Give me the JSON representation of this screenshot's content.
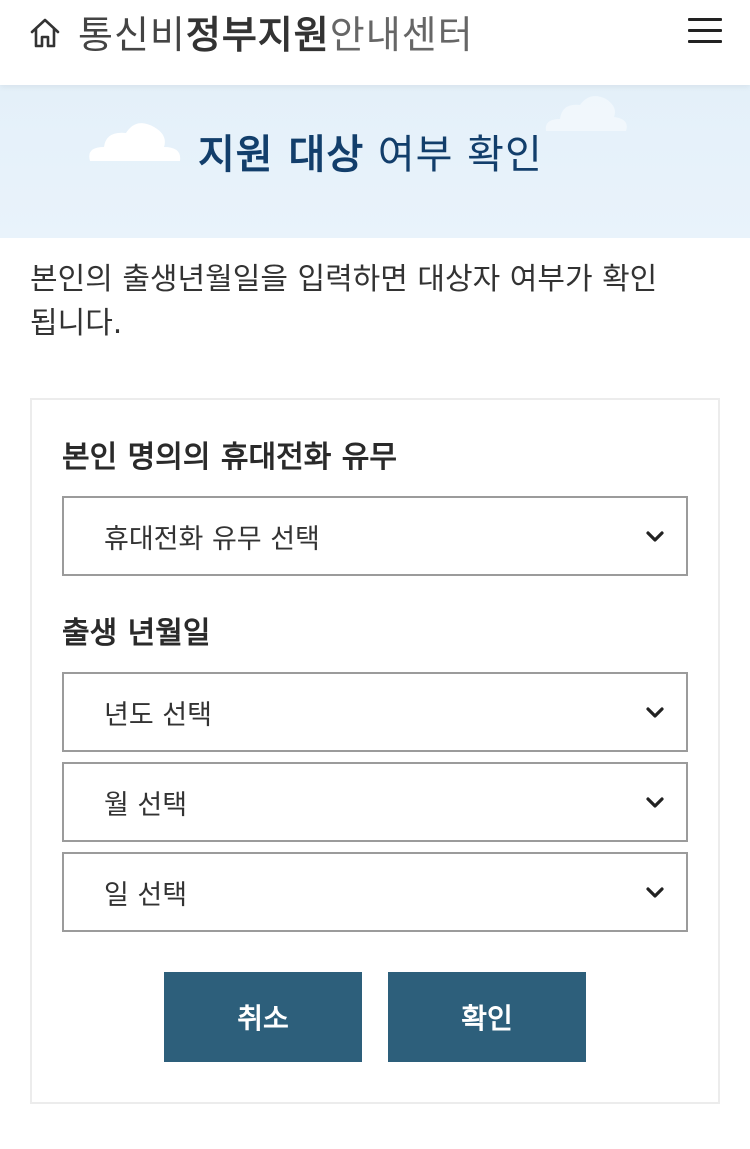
{
  "header": {
    "title_part1": "통신비",
    "title_part2": "정부지원",
    "title_part3": "안내센터",
    "home_icon": "home-icon",
    "menu_icon": "hamburger-menu-icon"
  },
  "banner": {
    "title_bold": "지원 대상",
    "title_regular": "여부 확인"
  },
  "intro": {
    "text": "본인의 출생년월일을 입력하면 대상자 여부가 확인 됩니다."
  },
  "form": {
    "phone_label": "본인 명의의 휴대전화 유무",
    "phone_select": "휴대전화 유무 선택",
    "birth_label": "출생 년월일",
    "year_select": "년도 선택",
    "month_select": "월 선택",
    "day_select": "일 선택",
    "cancel_label": "취소",
    "confirm_label": "확인"
  },
  "colors": {
    "accent": "#2d5f7b",
    "banner_bg": "#e6f1fa",
    "banner_title": "#123e6b"
  }
}
